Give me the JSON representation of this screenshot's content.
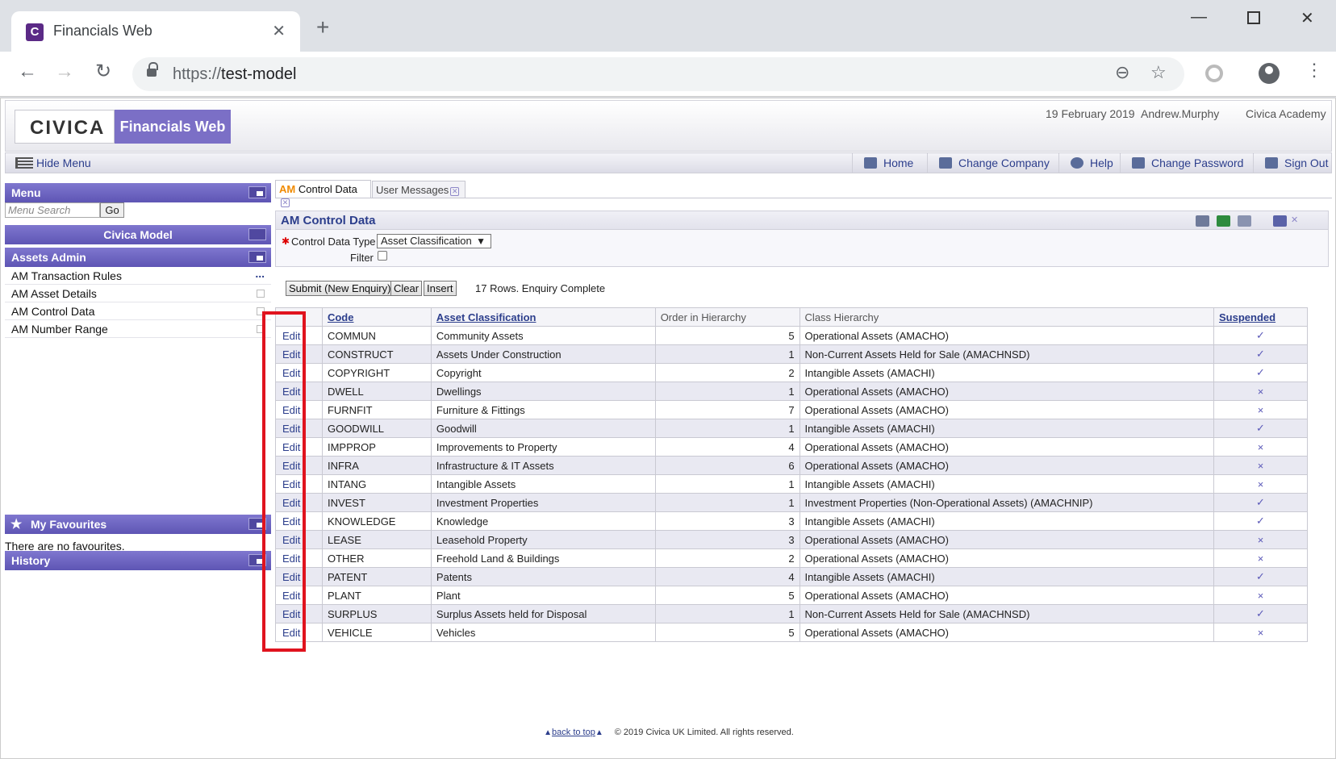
{
  "browser": {
    "tab_title": "Financials Web",
    "favicon_letter": "C",
    "url_scheme": "https://",
    "url_host": "test-model"
  },
  "header": {
    "logo_text": "CIVICA",
    "product": "Financials Web",
    "date": "19 February 2019",
    "user": "Andrew.Murphy",
    "org": "Civica Academy"
  },
  "topnav": {
    "hide_menu": "Hide Menu",
    "items": [
      "Home",
      "Change Company",
      "Help",
      "Change Password",
      "Sign Out"
    ]
  },
  "sidebar": {
    "menu_title": "Menu",
    "search_placeholder": "Menu Search",
    "go_label": "Go",
    "model_title": "Civica Model",
    "section_title": "Assets Admin",
    "items": [
      "AM Transaction Rules",
      "AM Asset Details",
      "AM Control Data",
      "AM Number Range"
    ],
    "favourites_title": "My Favourites",
    "no_favourites": "There are no favourites.",
    "history_title": "History"
  },
  "tabs": [
    {
      "prefix": "AM",
      "label": "Control Data"
    },
    {
      "label": "User Messages"
    }
  ],
  "page": {
    "title": "AM Control Data",
    "control_type_label": "Control Data Type",
    "control_type_value": "Asset Classification",
    "filter_label": "Filter",
    "buttons": {
      "submit": "Submit (New Enquiry)",
      "clear": "Clear",
      "insert": "Insert"
    },
    "status": "17 Rows. Enquiry Complete"
  },
  "table": {
    "headers": [
      "",
      "Code",
      "Asset Classification",
      "Order in Hierarchy",
      "Class Hierarchy",
      "Suspended"
    ],
    "edit_label": "Edit",
    "rows": [
      [
        "COMMUN",
        "Community Assets",
        "5",
        "Operational Assets (AMACHO)",
        "✓"
      ],
      [
        "CONSTRUCT",
        "Assets Under Construction",
        "1",
        "Non-Current Assets Held for Sale (AMACHNSD)",
        "✓"
      ],
      [
        "COPYRIGHT",
        "Copyright",
        "2",
        "Intangible Assets (AMACHI)",
        "✓"
      ],
      [
        "DWELL",
        "Dwellings",
        "1",
        "Operational Assets (AMACHO)",
        "×"
      ],
      [
        "FURNFIT",
        "Furniture & Fittings",
        "7",
        "Operational Assets (AMACHO)",
        "×"
      ],
      [
        "GOODWILL",
        "Goodwill",
        "1",
        "Intangible Assets (AMACHI)",
        "✓"
      ],
      [
        "IMPPROP",
        "Improvements to Property",
        "4",
        "Operational Assets (AMACHO)",
        "×"
      ],
      [
        "INFRA",
        "Infrastructure & IT Assets",
        "6",
        "Operational Assets (AMACHO)",
        "×"
      ],
      [
        "INTANG",
        "Intangible Assets",
        "1",
        "Intangible Assets (AMACHI)",
        "×"
      ],
      [
        "INVEST",
        "Investment Properties",
        "1",
        "Investment Properties (Non-Operational Assets) (AMACHNIP)",
        "✓"
      ],
      [
        "KNOWLEDGE",
        "Knowledge",
        "3",
        "Intangible Assets (AMACHI)",
        "✓"
      ],
      [
        "LEASE",
        "Leasehold Property",
        "3",
        "Operational Assets (AMACHO)",
        "×"
      ],
      [
        "OTHER",
        "Freehold Land & Buildings",
        "2",
        "Operational Assets (AMACHO)",
        "×"
      ],
      [
        "PATENT",
        "Patents",
        "4",
        "Intangible Assets (AMACHI)",
        "✓"
      ],
      [
        "PLANT",
        "Plant",
        "5",
        "Operational Assets (AMACHO)",
        "×"
      ],
      [
        "SURPLUS",
        "Surplus Assets held for Disposal",
        "1",
        "Non-Current Assets Held for Sale (AMACHNSD)",
        "✓"
      ],
      [
        "VEHICLE",
        "Vehicles",
        "5",
        "Operational Assets (AMACHO)",
        "×"
      ]
    ]
  },
  "footer": {
    "back_to_top": "back to top",
    "copyright": "© 2019 Civica UK Limited. All rights reserved."
  },
  "colors": {
    "accent": "#6c63c4",
    "link": "#2c3e8c",
    "highlight_box": "#e0131e"
  }
}
